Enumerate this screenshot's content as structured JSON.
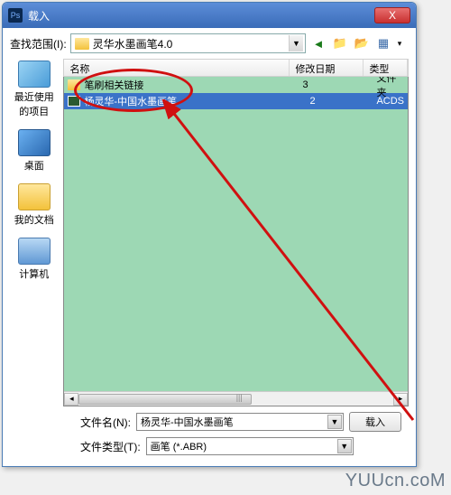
{
  "titlebar": {
    "title": "载入",
    "close": "X"
  },
  "pathrow": {
    "label": "查找范围(I):",
    "folder": "灵华水墨画笔4.0"
  },
  "toolbar_icons": {
    "back": "◄",
    "up": "📁",
    "new": "📂",
    "view": "▦",
    "view_arrow": "▾"
  },
  "places": {
    "recent": "最近使用的项目",
    "desktop": "桌面",
    "documents": "我的文档",
    "computer": "计算机"
  },
  "columns": {
    "name": "名称",
    "date": "修改日期",
    "type": "类型"
  },
  "files": [
    {
      "name": "笔刷相关链接",
      "date": "3",
      "type": "文件夹",
      "kind": "folder"
    },
    {
      "name": "杨灵华-中国水墨画笔",
      "date": "2",
      "type": "ACDS",
      "kind": "abr",
      "selected": true
    }
  ],
  "filename": {
    "label": "文件名(N):",
    "value": "杨灵华-中国水墨画笔"
  },
  "filetype": {
    "label": "文件类型(T):",
    "value": "画笔 (*.ABR)"
  },
  "buttons": {
    "load": "载入"
  },
  "watermark": "YUUcn.coM",
  "scroll_marker": "|||"
}
